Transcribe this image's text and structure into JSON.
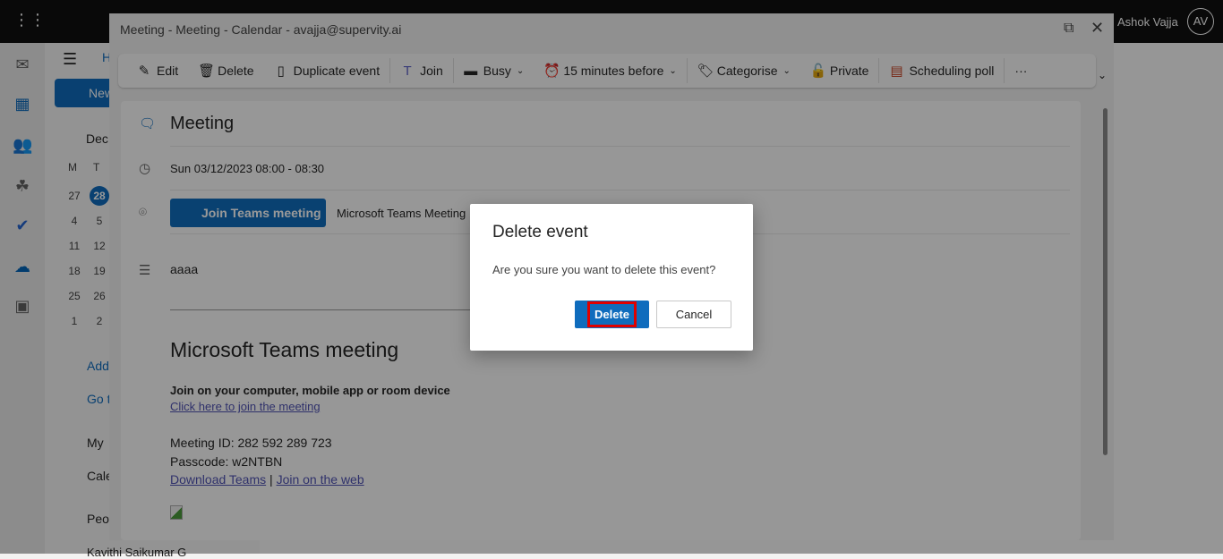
{
  "topbar": {
    "user_name": "Ashok Vajja",
    "avatar_initials": "AV"
  },
  "folder": {
    "new_label": "New",
    "month": "Dec",
    "weekdays": [
      "M",
      "T"
    ],
    "weeks": [
      [
        "27",
        "28"
      ],
      [
        "4",
        "5"
      ],
      [
        "11",
        "12"
      ],
      [
        "18",
        "19"
      ],
      [
        "25",
        "26"
      ],
      [
        "1",
        "2"
      ]
    ],
    "today": "28",
    "add_label": "Add",
    "goto_label": "Go t",
    "my_label": "My",
    "calendar_label": "Cale",
    "people_label": "Peo",
    "person": "Kavithi Saikumar G",
    "tab_home": "H"
  },
  "window": {
    "title": "Meeting - Meeting - Calendar - avajja@supervity.ai"
  },
  "toolbar": {
    "edit": "Edit",
    "delete": "Delete",
    "duplicate": "Duplicate event",
    "join": "Join",
    "busy": "Busy",
    "reminder": "15 minutes before",
    "categorise": "Categorise",
    "private": "Private",
    "scheduling_poll": "Scheduling poll",
    "more": "···"
  },
  "event": {
    "title": "Meeting",
    "datetime": "Sun 03/12/2023 08:00 - 08:30",
    "join_button": "Join Teams meeting",
    "location": "Microsoft Teams Meeting",
    "notes": "aaaa",
    "teams_heading": "Microsoft Teams meeting",
    "join_info": "Join on your computer, mobile app or room device",
    "join_link": "Click here to join the meeting",
    "meeting_id": "Meeting ID: 282 592 289 723",
    "passcode": "Passcode: w2NTBN",
    "download_link": "Download Teams",
    "sep": "|",
    "web_link": "Join on the web"
  },
  "dialog": {
    "title": "Delete event",
    "message": "Are you sure you want to delete this event?",
    "confirm": "Delete",
    "cancel": "Cancel",
    "accent": "#0f6cbd"
  }
}
